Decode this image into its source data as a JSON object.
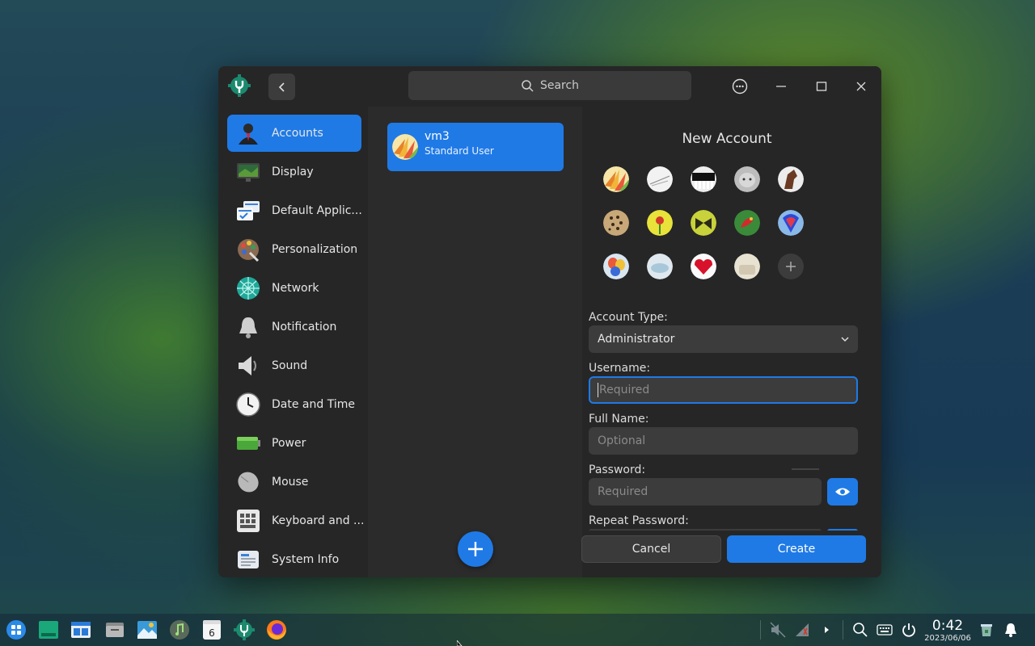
{
  "titlebar": {
    "search_placeholder": "Search",
    "icons": [
      "control-center-logo",
      "back-icon",
      "search-icon",
      "more-icon",
      "minimize-icon",
      "maximize-icon",
      "close-icon"
    ]
  },
  "sidebar": {
    "items": [
      {
        "label": "Accounts",
        "icon": "accounts-icon",
        "active": true
      },
      {
        "label": "Display",
        "icon": "display-icon"
      },
      {
        "label": "Default Applic...",
        "icon": "default-apps-icon"
      },
      {
        "label": "Personalization",
        "icon": "personalization-icon"
      },
      {
        "label": "Network",
        "icon": "network-icon"
      },
      {
        "label": "Notification",
        "icon": "notification-icon"
      },
      {
        "label": "Sound",
        "icon": "sound-icon"
      },
      {
        "label": "Date and Time",
        "icon": "clock-icon"
      },
      {
        "label": "Power",
        "icon": "battery-icon"
      },
      {
        "label": "Mouse",
        "icon": "mouse-icon"
      },
      {
        "label": "Keyboard and ...",
        "icon": "keyboard-icon"
      },
      {
        "label": "System Info",
        "icon": "system-info-icon"
      }
    ]
  },
  "accounts": {
    "user": {
      "name": "vm3",
      "type": "Standard User"
    }
  },
  "new_account": {
    "title": "New Account",
    "account_type_label": "Account Type:",
    "account_type_value": "Administrator",
    "username_label": "Username:",
    "username_placeholder": "Required",
    "fullname_label": "Full Name:",
    "fullname_placeholder": "Optional",
    "password_label": "Password:",
    "password_placeholder": "Required",
    "repeat_password_label": "Repeat Password:",
    "cancel_label": "Cancel",
    "create_label": "Create"
  },
  "taskbar": {
    "apps": [
      "launcher-icon",
      "multitask-icon",
      "workspace-icon",
      "file-manager-icon",
      "image-viewer-icon",
      "music-icon",
      "calendar-icon",
      "control-center-icon",
      "firefox-icon"
    ],
    "calendar_day": "6",
    "tray": [
      "mute-icon",
      "network-tray-icon",
      "arrow-right-icon",
      "search-icon",
      "keyboard-icon",
      "power-icon",
      "trash-icon",
      "bell-icon"
    ],
    "time": "0:42",
    "date": "2023/06/06"
  },
  "colors": {
    "accent": "#1f7ae6",
    "window_bg": "#262626",
    "field_bg": "#3c3c3c"
  }
}
